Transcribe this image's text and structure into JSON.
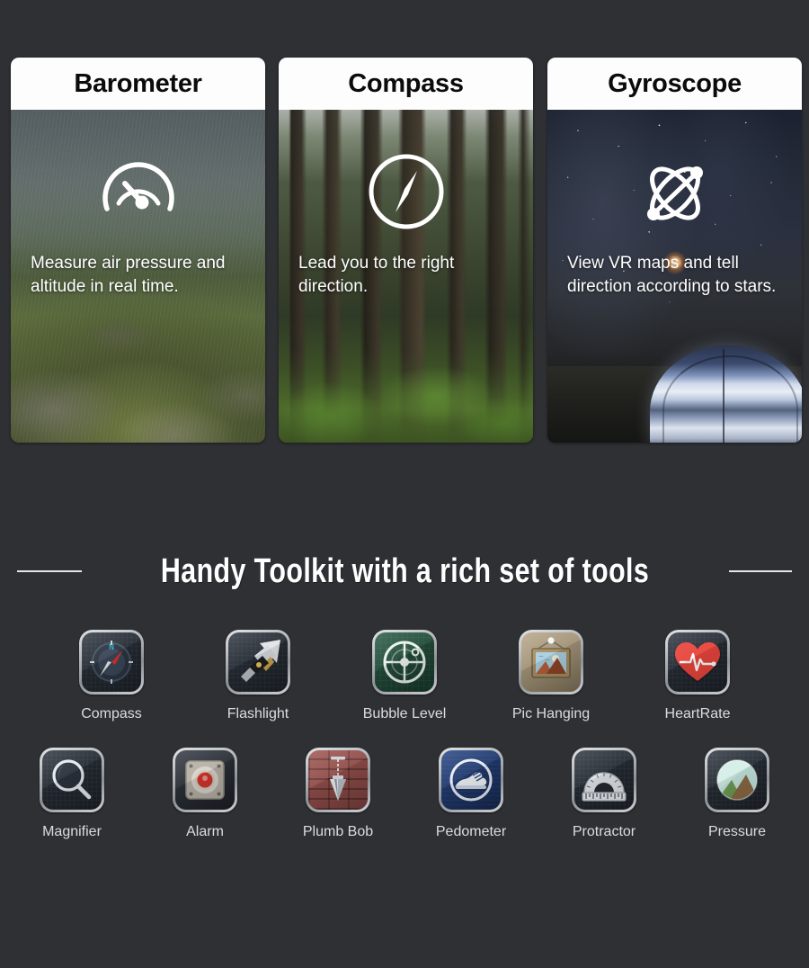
{
  "page": {
    "background_color": "#2e3034"
  },
  "feature_cards": [
    {
      "id": "barometer",
      "title": "Barometer",
      "caption": "Measure air pressure and altitude in real time.",
      "icon": "gauge-icon",
      "photo": "mountain-ridge-photo"
    },
    {
      "id": "compass",
      "title": "Compass",
      "caption": "Lead you to the right direction.",
      "icon": "compass-needle-icon",
      "photo": "forest-photo"
    },
    {
      "id": "gyroscope",
      "title": "Gyroscope",
      "caption": "View VR maps and tell direction according to stars.",
      "icon": "atom-orbit-icon",
      "photo": "starry-night-tent-photo"
    }
  ],
  "section": {
    "title": "Handy Toolkit with a rich set of tools",
    "rule_color": "#e6e6e6"
  },
  "tools": {
    "row1": [
      {
        "label": "Compass",
        "icon": "compass-app-icon"
      },
      {
        "label": "Flashlight",
        "icon": "flashlight-app-icon"
      },
      {
        "label": "Bubble Level",
        "icon": "bubble-level-app-icon"
      },
      {
        "label": "Pic Hanging",
        "icon": "picture-frame-app-icon"
      },
      {
        "label": "HeartRate",
        "icon": "heart-rate-app-icon"
      }
    ],
    "row2": [
      {
        "label": "Magnifier",
        "icon": "magnifier-app-icon"
      },
      {
        "label": "Alarm",
        "icon": "alarm-button-app-icon"
      },
      {
        "label": "Plumb Bob",
        "icon": "plumb-bob-app-icon"
      },
      {
        "label": "Pedometer",
        "icon": "sneaker-app-icon"
      },
      {
        "label": "Protractor",
        "icon": "protractor-app-icon"
      },
      {
        "label": "Pressure",
        "icon": "pressure-landscape-app-icon"
      }
    ]
  }
}
